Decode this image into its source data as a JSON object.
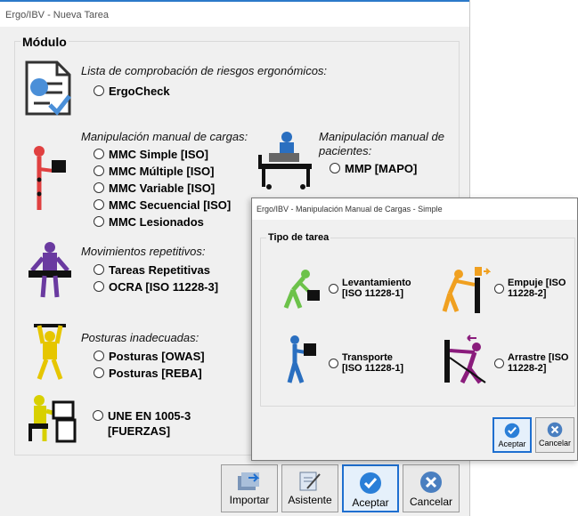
{
  "main": {
    "title": "Ergo/IBV - Nueva Tarea",
    "module_title": "Módulo",
    "checklist": {
      "title": "Lista de comprobación de riesgos ergonómicos:",
      "options": [
        "ErgoCheck"
      ]
    },
    "mmc": {
      "title": "Manipulación manual de cargas:",
      "options": [
        "MMC Simple [ISO]",
        "MMC Múltiple [ISO]",
        "MMC Variable [ISO]",
        "MMC Secuencial [ISO]",
        "MMC Lesionados"
      ]
    },
    "patients": {
      "title_line1": "Manipulación manual de",
      "title_line2": "pacientes:",
      "options": [
        "MMP [MAPO]"
      ]
    },
    "repetitive": {
      "title": "Movimientos repetitivos:",
      "options": [
        "Tareas Repetitivas",
        "OCRA [ISO 11228-3]"
      ]
    },
    "postures": {
      "title": "Posturas inadecuadas:",
      "options": [
        "Posturas [OWAS]",
        "Posturas [REBA]"
      ]
    },
    "forces": {
      "option_line1": "UNE EN 1005-3",
      "option_line2": "[FUERZAS]"
    },
    "buttons": {
      "import": "Importar",
      "assistant": "Asistente",
      "accept": "Aceptar",
      "cancel": "Cancelar"
    }
  },
  "dialog": {
    "title": "Ergo/IBV - Manipulación Manual de Cargas - Simple",
    "group_title": "Tipo de tarea",
    "tasks": [
      {
        "line1": "Levantamiento",
        "line2": "[ISO 11228-1]"
      },
      {
        "line1": "Empuje [ISO",
        "line2": "11228-2]"
      },
      {
        "line1": "Transporte",
        "line2": "[ISO 11228-1]"
      },
      {
        "line1": "Arrastre [ISO",
        "line2": "11228-2]"
      }
    ],
    "buttons": {
      "accept": "Aceptar",
      "cancel": "Cancelar"
    }
  },
  "colors": {
    "accent": "#1e6fd0",
    "red": "#e04040",
    "purple": "#6a3aa0",
    "yellow": "#e6c600",
    "blue": "#2a6fc0",
    "green": "#6cc24a",
    "orange": "#f0a020"
  }
}
